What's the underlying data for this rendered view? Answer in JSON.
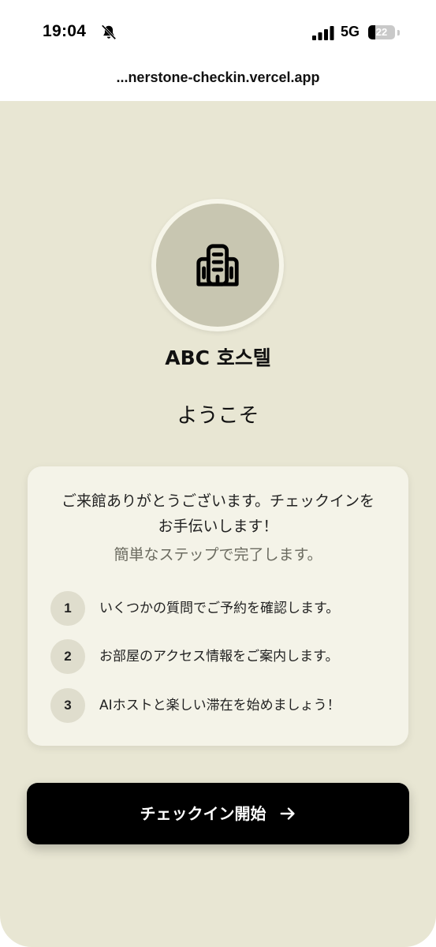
{
  "status_bar": {
    "time": "19:04",
    "network": "5G",
    "battery_level": "22",
    "icons": [
      "bell-slash-icon",
      "cellular-signal-icon",
      "battery-icon"
    ]
  },
  "browser": {
    "url": "...nerstone-checkin.vercel.app"
  },
  "header": {
    "logo_icon": "building-icon",
    "hostel_name": "ABC 호스텔",
    "welcome": "ようこそ"
  },
  "card": {
    "intro_line1": "ご来館ありがとうございます。チェックインを",
    "intro_line2": "お手伝いします！",
    "intro_sub": "簡単なステップで完了します。",
    "steps": [
      {
        "number": "1",
        "text": "いくつかの質問でご予約を確認します。"
      },
      {
        "number": "2",
        "text": "お部屋のアクセス情報をご案内します。"
      },
      {
        "number": "3",
        "text": "AIホストと楽しい滞在を始めましょう！"
      }
    ]
  },
  "cta": {
    "label": "チェックイン開始",
    "icon": "arrow-right-icon"
  },
  "colors": {
    "background": "#e8e6d3",
    "card": "#f4f3e8",
    "button": "#000000",
    "logo_circle": "#c8c6b1"
  }
}
